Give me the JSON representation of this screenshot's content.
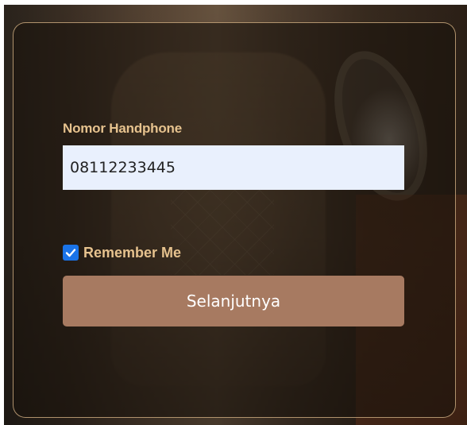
{
  "form": {
    "phone_label": "Nomor Handphone",
    "phone_value": "08112233445",
    "remember_label": "Remember Me",
    "remember_checked": true,
    "submit_label": "Selanjutnya"
  },
  "colors": {
    "label": "#e6c28e",
    "input_background": "#e9f0fd",
    "button": "#a77a61",
    "checkbox": "#1a73e8",
    "card_border": "#c9a87c"
  },
  "icons": {
    "checkbox_mark": "checkmark-icon"
  }
}
